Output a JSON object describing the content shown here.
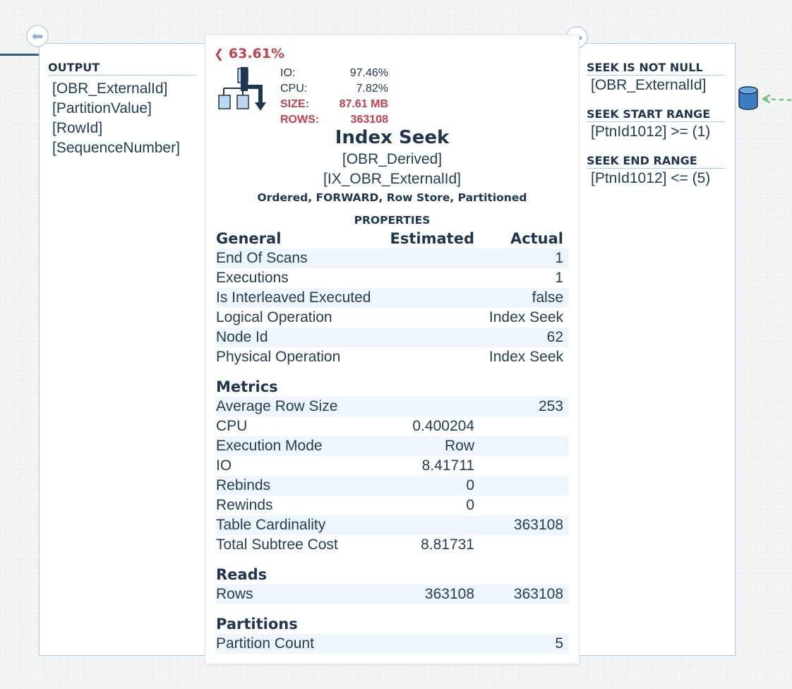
{
  "left_panel": {
    "header": "OUTPUT",
    "items": [
      "[OBR_ExternalId]",
      "[PartitionValue]",
      "[RowId]",
      "[SequenceNumber]"
    ]
  },
  "node": {
    "cost_percent": "63.61%",
    "stats": [
      {
        "label": "IO:",
        "value": "97.46%",
        "highlight": false
      },
      {
        "label": "CPU:",
        "value": "7.82%",
        "highlight": false
      },
      {
        "label": "SIZE:",
        "value": "87.61 MB",
        "highlight": true
      },
      {
        "label": "ROWS:",
        "value": "363108",
        "highlight": true
      }
    ],
    "title": "Index Seek",
    "object_table": "[OBR_Derived]",
    "object_index": "[IX_OBR_ExternalId]",
    "attributes": "Ordered, FORWARD, Row Store, Partitioned",
    "properties_header": "PROPERTIES",
    "columns": {
      "estimated": "Estimated",
      "actual": "Actual"
    },
    "sections": [
      {
        "name": "General",
        "rows": [
          {
            "label": "End Of Scans",
            "estimated": "",
            "actual": "1"
          },
          {
            "label": "Executions",
            "estimated": "",
            "actual": "1"
          },
          {
            "label": "Is Interleaved Executed",
            "estimated": "",
            "actual": "false"
          },
          {
            "label": "Logical Operation",
            "estimated": "",
            "actual": "Index Seek"
          },
          {
            "label": "Node Id",
            "estimated": "",
            "actual": "62"
          },
          {
            "label": "Physical Operation",
            "estimated": "",
            "actual": "Index Seek"
          }
        ]
      },
      {
        "name": "Metrics",
        "rows": [
          {
            "label": "Average Row Size",
            "estimated": "",
            "actual": "253"
          },
          {
            "label": "CPU",
            "estimated": "0.400204",
            "actual": ""
          },
          {
            "label": "Execution Mode",
            "estimated": "Row",
            "actual": ""
          },
          {
            "label": "IO",
            "estimated": "8.41711",
            "actual": ""
          },
          {
            "label": "Rebinds",
            "estimated": "0",
            "actual": ""
          },
          {
            "label": "Rewinds",
            "estimated": "0",
            "actual": ""
          },
          {
            "label": "Table Cardinality",
            "estimated": "",
            "actual": "363108"
          },
          {
            "label": "Total Subtree Cost",
            "estimated": "8.81731",
            "actual": ""
          }
        ]
      },
      {
        "name": "Reads",
        "rows": [
          {
            "label": "Rows",
            "estimated": "363108",
            "actual": "363108"
          }
        ]
      },
      {
        "name": "Partitions",
        "rows": [
          {
            "label": "Partition Count",
            "estimated": "",
            "actual": "5"
          }
        ]
      }
    ]
  },
  "right_panel": {
    "groups": [
      {
        "header": "SEEK IS NOT NULL",
        "items": [
          "[OBR_ExternalId]"
        ]
      },
      {
        "header": "SEEK START RANGE",
        "items": [
          "[PtnId1012] >= (1)"
        ]
      },
      {
        "header": "SEEK END RANGE",
        "items": [
          "[PtnId1012] <= (5)"
        ]
      }
    ]
  },
  "colors": {
    "accent_red": "#c0424c",
    "navy": "#1f3550",
    "panel_border": "#a8cbe6",
    "row_stripe": "#eef5fc",
    "icon_blue": "#3b7fc2"
  }
}
